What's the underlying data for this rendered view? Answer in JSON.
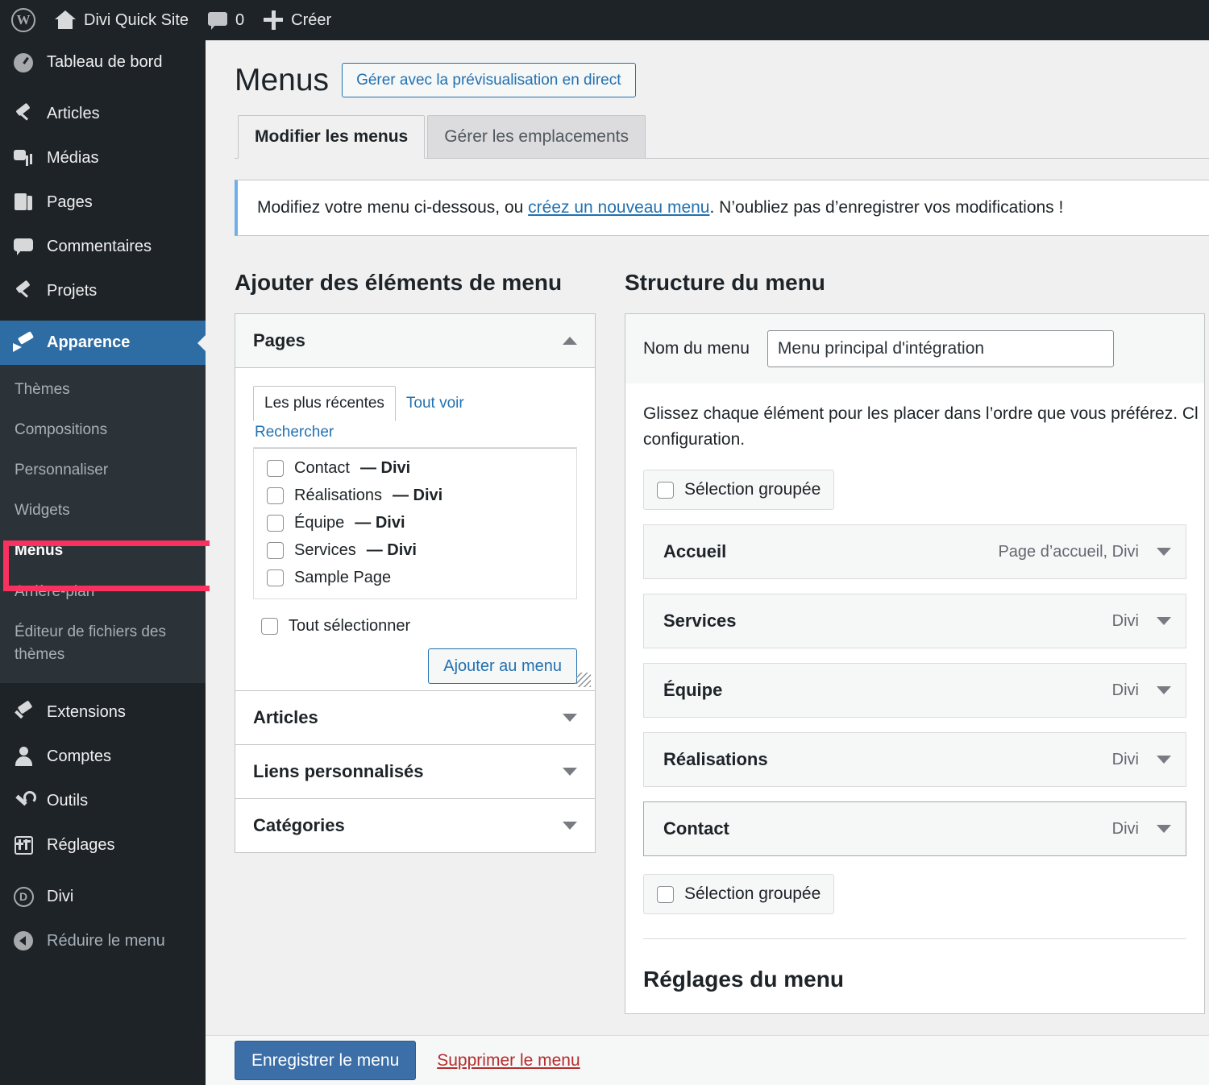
{
  "adminbar": {
    "site_title": "Divi Quick Site",
    "comment_count": "0",
    "create_label": "Créer",
    "icons": {
      "wp": "wordpress-logo-icon",
      "home": "home-icon",
      "comments": "comment-bubble-icon",
      "plus": "plus-icon"
    }
  },
  "sidebar": {
    "items": [
      {
        "label": "Tableau de bord",
        "icon": "dashboard-icon"
      },
      {
        "label": "Articles",
        "icon": "pin-icon"
      },
      {
        "label": "Médias",
        "icon": "media-icon"
      },
      {
        "label": "Pages",
        "icon": "pages-icon"
      },
      {
        "label": "Commentaires",
        "icon": "comment-icon"
      },
      {
        "label": "Projets",
        "icon": "pin-icon"
      },
      {
        "label": "Apparence",
        "icon": "brush-icon"
      },
      {
        "label": "Extensions",
        "icon": "plug-icon"
      },
      {
        "label": "Comptes",
        "icon": "user-icon"
      },
      {
        "label": "Outils",
        "icon": "wrench-icon"
      },
      {
        "label": "Réglages",
        "icon": "settings-icon"
      },
      {
        "label": "Divi",
        "icon": "divi-icon"
      },
      {
        "label": "Réduire le menu",
        "icon": "collapse-icon"
      }
    ],
    "appearance_submenu": [
      {
        "label": "Thèmes"
      },
      {
        "label": "Compositions"
      },
      {
        "label": "Personnaliser"
      },
      {
        "label": "Widgets"
      },
      {
        "label": "Menus"
      },
      {
        "label": "Arrière-plan"
      },
      {
        "label": "Éditeur de fichiers des thèmes"
      }
    ],
    "active_submenu": "Menus",
    "highlight_color": "#f9315f",
    "current_color": "#2e6da4"
  },
  "page": {
    "title": "Menus",
    "live_preview_button": "Gérer avec la prévisualisation en direct",
    "tabs": [
      {
        "label": "Modifier les menus",
        "active": true
      },
      {
        "label": "Gérer les emplacements",
        "active": false
      }
    ],
    "notice": {
      "before_link": "Modifiez votre menu ci-dessous, ou ",
      "link": "créez un nouveau menu",
      "after_link": ". N’oubliez pas d’enregistrer vos modifications !"
    }
  },
  "add_items": {
    "section_title": "Ajouter des éléments de menu",
    "pages_panel": {
      "title": "Pages",
      "toggle_icon": "chevron-up-icon",
      "subtabs": [
        {
          "label": "Les plus récentes",
          "active": true
        },
        {
          "label": "Tout voir",
          "active": false
        },
        {
          "label": "Rechercher",
          "active": false
        }
      ],
      "items": [
        {
          "name": "Contact",
          "suffix": "— Divi",
          "checked": false
        },
        {
          "name": "Réalisations",
          "suffix": "— Divi",
          "checked": false
        },
        {
          "name": "Équipe",
          "suffix": "— Divi",
          "checked": false
        },
        {
          "name": "Services",
          "suffix": "— Divi",
          "checked": false
        },
        {
          "name": "Sample Page",
          "suffix": "",
          "checked": false
        }
      ],
      "select_all_label": "Tout sélectionner",
      "add_button": "Ajouter au menu"
    },
    "collapsed_panels": [
      {
        "title": "Articles",
        "toggle_icon": "chevron-down-icon"
      },
      {
        "title": "Liens personnalisés",
        "toggle_icon": "chevron-down-icon"
      },
      {
        "title": "Catégories",
        "toggle_icon": "chevron-down-icon"
      }
    ]
  },
  "structure": {
    "section_title": "Structure du menu",
    "menu_name_label": "Nom du menu",
    "menu_name_value": "Menu principal d'intégration",
    "hint": "Glissez chaque élément pour les placer dans l’ordre que vous préférez. Cl",
    "hint_line2": "configuration.",
    "bulk_select_top": "Sélection groupée",
    "bulk_select_bottom": "Sélection groupée",
    "items": [
      {
        "label": "Accueil",
        "meta": "Page d’accueil, Divi"
      },
      {
        "label": "Services",
        "meta": "Divi"
      },
      {
        "label": "Équipe",
        "meta": "Divi"
      },
      {
        "label": "Réalisations",
        "meta": "Divi"
      },
      {
        "label": "Contact",
        "meta": "Divi"
      }
    ],
    "settings_title": "Réglages du menu"
  },
  "footer": {
    "save_label": "Enregistrer le menu",
    "delete_label": "Supprimer le menu",
    "save_color": "#3c6fa8",
    "delete_color": "#b32d2e"
  }
}
